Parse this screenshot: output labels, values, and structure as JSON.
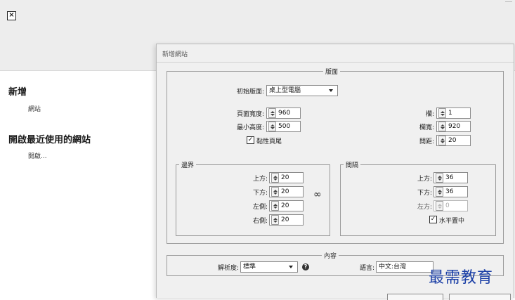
{
  "app": {
    "close_glyph": "×"
  },
  "sidebar": {
    "new_heading": "新增",
    "new_site": "網站",
    "recent_heading": "開啟最近使用的網站",
    "open": "開啟..."
  },
  "dialog": {
    "title": "新增網站",
    "layout": {
      "legend": "版面",
      "initial_layout_label": "初始版面:",
      "initial_layout_value": "桌上型電腦",
      "page_width_label": "頁面寬度:",
      "page_width": "960",
      "min_height_label": "最小高度:",
      "min_height": "500",
      "sticky_footer_label": "黏性頁尾",
      "sticky_footer_checked": true,
      "columns_label": "欄:",
      "columns": "1",
      "column_width_label": "欄寬:",
      "column_width": "920",
      "gutter_label": "間距:",
      "gutter": "20"
    },
    "margins": {
      "legend": "邊界",
      "top_label": "上方:",
      "top": "20",
      "bottom_label": "下方:",
      "bottom": "20",
      "left_label": "左側:",
      "left": "20",
      "right_label": "右側:",
      "right": "20"
    },
    "padding": {
      "legend": "間隔",
      "top_label": "上方:",
      "top": "36",
      "bottom_label": "下方:",
      "bottom": "36",
      "left_label": "左方:",
      "left": "0",
      "center_label": "水平置中",
      "center_checked": true
    },
    "content": {
      "legend": "內容",
      "resolution_label": "解析度:",
      "resolution_value": "標準",
      "language_label": "語言:",
      "language_value": "中文:台灣"
    }
  },
  "watermark": "最需教育",
  "colors": {
    "watermark": "#1b3fa6"
  }
}
